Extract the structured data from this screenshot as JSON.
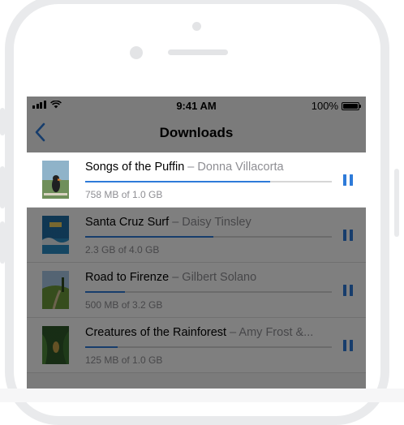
{
  "status_bar": {
    "time": "9:41 AM",
    "battery": "100%"
  },
  "nav": {
    "title": "Downloads",
    "back_icon": "chevron-left-icon"
  },
  "downloads": [
    {
      "title": "Songs of the Puffin",
      "separator": " – ",
      "author": "Donna Villacorta",
      "size": "758 MB of 1.0 GB",
      "progress": 0.75
    },
    {
      "title": "Santa Cruz Surf",
      "separator": " – ",
      "author": "Daisy Tinsley",
      "size": "2.3 GB of 4.0 GB",
      "progress": 0.52
    },
    {
      "title": "Road to Firenze",
      "separator": " – ",
      "author": "Gilbert Solano",
      "size": "500 MB of 3.2 GB",
      "progress": 0.16
    },
    {
      "title": "Creatures of the Rainforest",
      "separator": " – ",
      "author": "Amy Frost &...",
      "size": "125 MB of 1.0 GB",
      "progress": 0.13
    }
  ],
  "colors": {
    "accent": "#2e7bd9",
    "secondary_text": "#8e8e93",
    "device_frame": "#e9eaec"
  }
}
